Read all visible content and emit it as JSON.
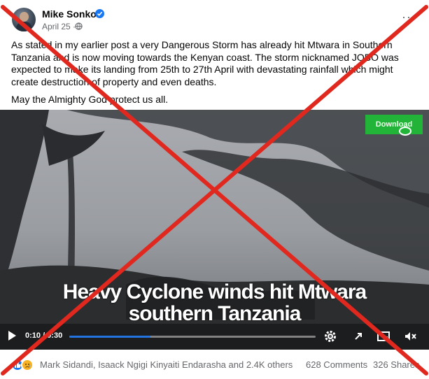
{
  "post": {
    "author": "Mike Sonko.",
    "date": "April 25 ·",
    "menu": "···",
    "paragraph1": "As stated in my earlier post a very Dangerous Storm has already hit Mtwara in Southern Tanzania and is now moving towards the Kenyan coast. The storm nicknamed JOBO was expected to make its landing from 25th to 27th April with devastating rainfall which might create destruction of property and even deaths.",
    "paragraph2": "May the Almighty God protect us all."
  },
  "video": {
    "caption_line1": "Heavy Cyclone  winds hit Mtwara",
    "caption_line2": "southern Tanzania",
    "download_label": "Download",
    "time": "0:10 / 0:30",
    "progress": 0.33
  },
  "footer": {
    "reactions_text": "Mark Sidandi, Isaack Ngigi Kinyaiti Endarasha and 2.4K others",
    "comments": "628 Comments",
    "shares": "326 Shares"
  },
  "colors": {
    "accent": "#1877f2",
    "download_bg": "#22b439",
    "false_mark": "#e0281f"
  }
}
